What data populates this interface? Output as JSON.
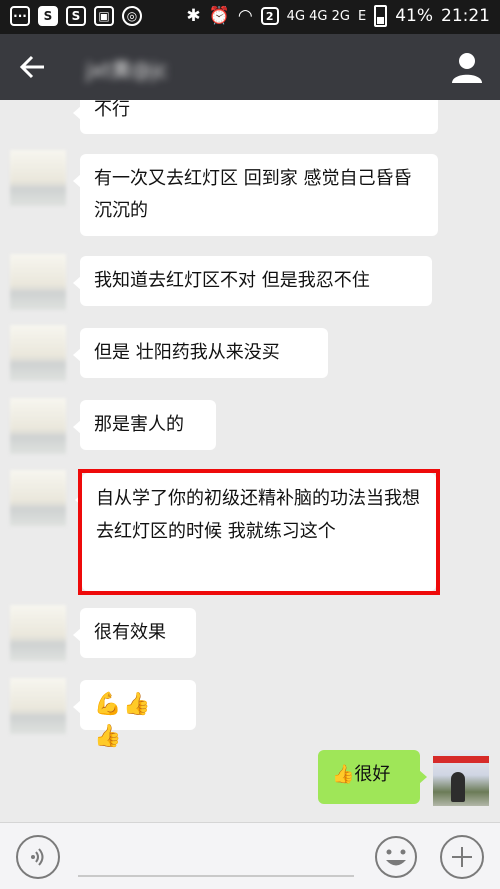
{
  "status_bar": {
    "icons_left": [
      "message-icon",
      "s-app-icon",
      "s-app-icon",
      "image-icon",
      "smart-icon"
    ],
    "network_labels": "4G 4G 2G",
    "sim_badge": "2",
    "carrier_e": "E",
    "battery_percent": "41%",
    "battery_level": 0.41,
    "time": "21:21"
  },
  "header": {
    "title": "jxt黄@jc",
    "back_icon": "arrow-left-icon",
    "profile_icon": "person-icon"
  },
  "messages": [
    {
      "side": "left",
      "text": "不行",
      "partial": true
    },
    {
      "side": "left",
      "text": "有一次又去红灯区 回到家 感觉自己昏昏沉沉的"
    },
    {
      "side": "left",
      "text": "我知道去红灯区不对 但是我忍不住"
    },
    {
      "side": "left",
      "text": "但是 壮阳药我从来没买"
    },
    {
      "side": "left",
      "text": "那是害人的"
    },
    {
      "side": "left",
      "text": "自从学了你的初级还精补脑的功法当我想去红灯区的时候 我就练习这个",
      "highlighted": true,
      "highlight_color": "#ee0a0a"
    },
    {
      "side": "left",
      "text": "很有效果"
    },
    {
      "side": "left",
      "text": "💪👍👍",
      "emoji_only": true
    },
    {
      "side": "right",
      "text": "👍很好"
    }
  ],
  "colors": {
    "header_bg": "#393a3f",
    "chat_bg": "#ebebeb",
    "sent_bubble": "#9fe658",
    "received_bubble": "#ffffff"
  }
}
